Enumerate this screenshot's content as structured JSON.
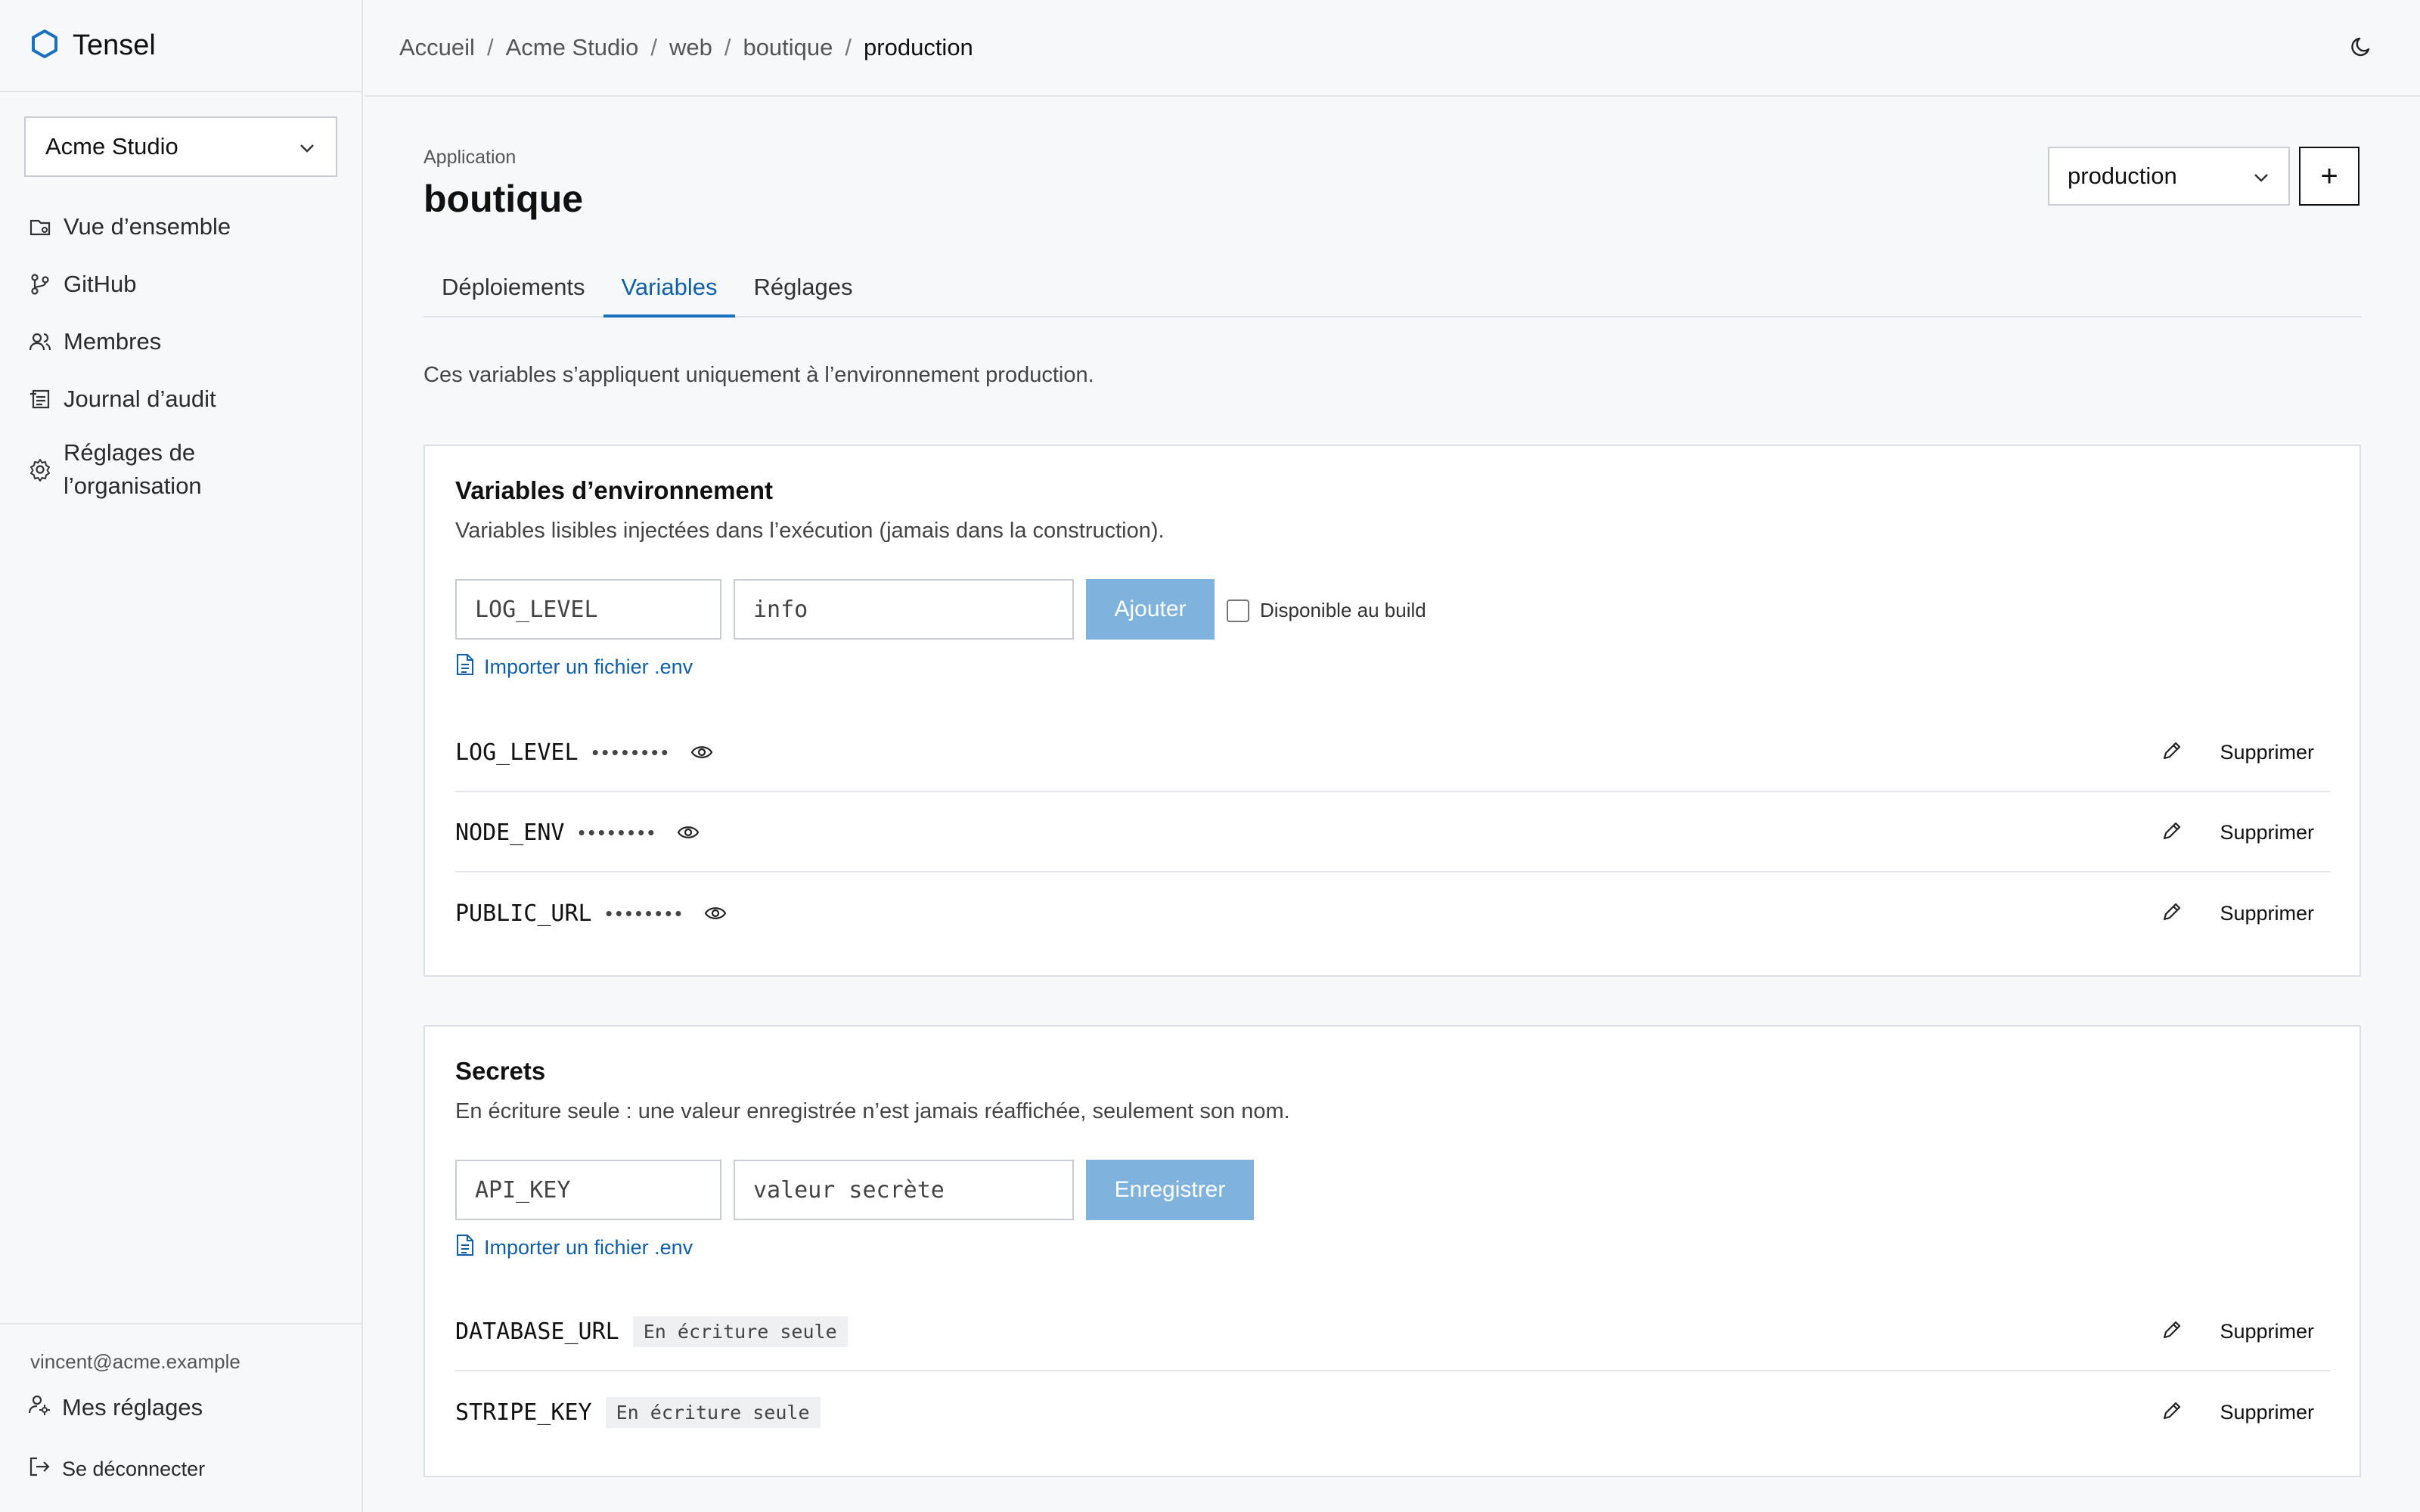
{
  "brand": {
    "name": "Tensel"
  },
  "sidebar": {
    "org_selector": "Acme Studio",
    "items": [
      {
        "label": "Vue d’ensemble",
        "icon": "overview-icon"
      },
      {
        "label": "GitHub",
        "icon": "git-branch-icon"
      },
      {
        "label": "Membres",
        "icon": "users-icon"
      },
      {
        "label": "Journal d’audit",
        "icon": "audit-log-icon"
      },
      {
        "label_line1": "Réglages de",
        "label_line2": "l’organisation",
        "icon": "gear-icon"
      }
    ],
    "user_email": "vincent@acme.example",
    "my_settings": "Mes réglages",
    "logout": "Se déconnecter"
  },
  "breadcrumb": {
    "items": [
      "Accueil",
      "Acme Studio",
      "web",
      "boutique"
    ],
    "current": "production",
    "separator": "/"
  },
  "app": {
    "eyebrow": "Application",
    "title": "boutique",
    "environment": "production",
    "add_label": "+"
  },
  "tabs": [
    {
      "label": "Déploiements",
      "active": false
    },
    {
      "label": "Variables",
      "active": true
    },
    {
      "label": "Réglages",
      "active": false
    }
  ],
  "scope_note": "Ces variables s’appliquent uniquement à l’environnement production.",
  "env_vars": {
    "title": "Variables d’environnement",
    "description": "Variables lisibles injectées dans l’exécution (jamais dans la construction).",
    "key_placeholder": "LOG_LEVEL",
    "value_placeholder": "info",
    "add_button": "Ajouter",
    "build_checkbox_label": "Disponible au build",
    "import_link": "Importer un fichier .env",
    "rows": [
      {
        "name": "LOG_LEVEL",
        "masked": "••••••••"
      },
      {
        "name": "NODE_ENV",
        "masked": "••••••••"
      },
      {
        "name": "PUBLIC_URL",
        "masked": "••••••••"
      }
    ],
    "delete_label": "Supprimer"
  },
  "secrets": {
    "title": "Secrets",
    "description": "En écriture seule : une valeur enregistrée n’est jamais réaffichée, seulement son nom.",
    "key_placeholder": "API_KEY",
    "value_placeholder": "valeur secrète",
    "save_button": "Enregistrer",
    "import_link": "Importer un fichier .env",
    "rows": [
      {
        "name": "DATABASE_URL",
        "badge": "En écriture seule"
      },
      {
        "name": "STRIPE_KEY",
        "badge": "En écriture seule"
      }
    ],
    "delete_label": "Supprimer"
  },
  "colors": {
    "accent": "#1a6fbf",
    "primary_button_disabled": "#7fb3dd",
    "link": "#0f5fa8"
  }
}
